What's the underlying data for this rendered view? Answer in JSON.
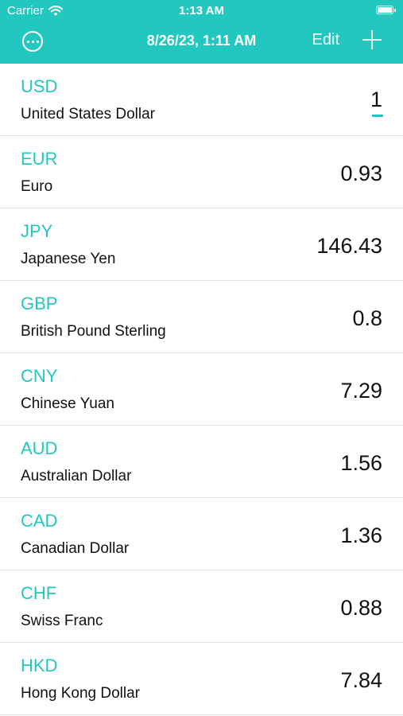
{
  "status": {
    "carrier": "Carrier",
    "time": "1:13 AM",
    "battery_level": 1.0
  },
  "navbar": {
    "title": "8/26/23, 1:11 AM",
    "edit_label": "Edit",
    "more_icon": "ellipsis-circle-icon",
    "add_icon": "plus-icon"
  },
  "accent_color": "#22c8c0",
  "currencies": [
    {
      "code": "USD",
      "name": "United States Dollar",
      "value": "1"
    },
    {
      "code": "EUR",
      "name": "Euro",
      "value": "0.93"
    },
    {
      "code": "JPY",
      "name": "Japanese Yen",
      "value": "146.43"
    },
    {
      "code": "GBP",
      "name": "British Pound Sterling",
      "value": "0.8"
    },
    {
      "code": "CNY",
      "name": "Chinese Yuan",
      "value": "7.29"
    },
    {
      "code": "AUD",
      "name": "Australian Dollar",
      "value": "1.56"
    },
    {
      "code": "CAD",
      "name": "Canadian Dollar",
      "value": "1.36"
    },
    {
      "code": "CHF",
      "name": "Swiss Franc",
      "value": "0.88"
    },
    {
      "code": "HKD",
      "name": "Hong Kong Dollar",
      "value": "7.84"
    }
  ]
}
